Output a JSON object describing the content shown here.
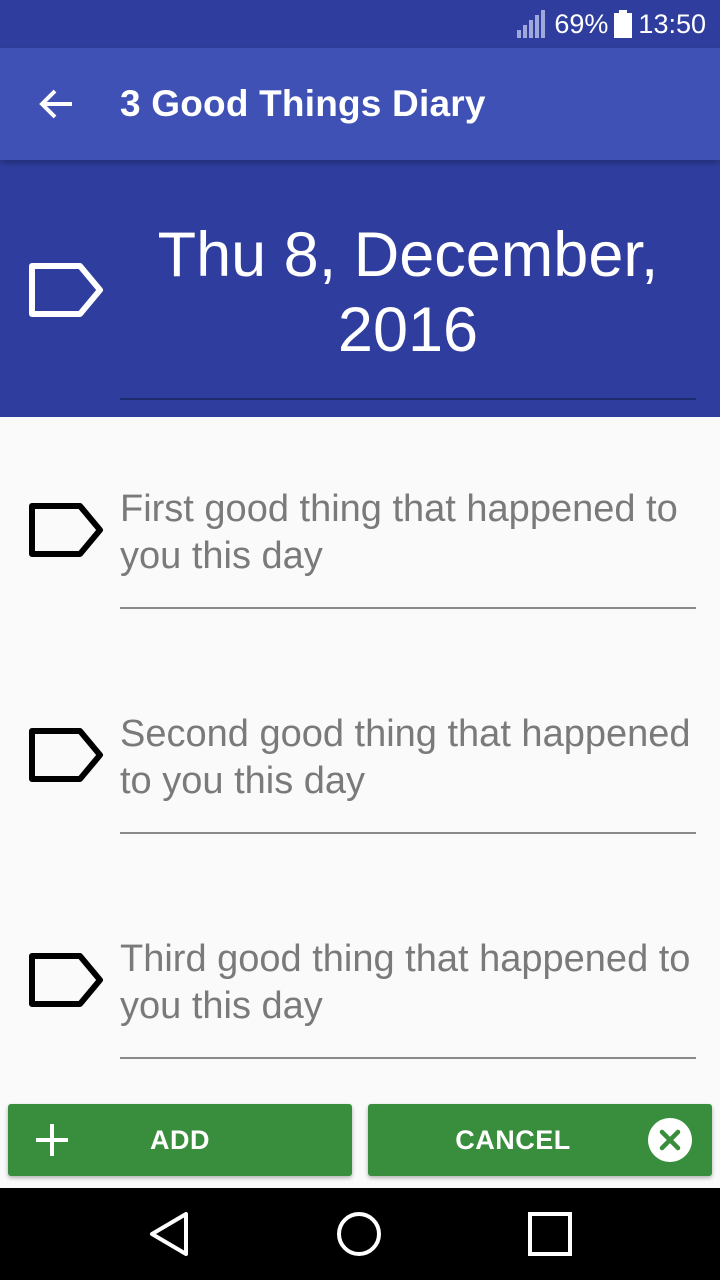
{
  "status_bar": {
    "battery": "69%",
    "time": "13:50"
  },
  "app_bar": {
    "title": "3 Good Things Diary"
  },
  "date_header": {
    "date": "Thu 8, December, 2016"
  },
  "entries": [
    {
      "placeholder": "First good thing that happened to you this day",
      "value": ""
    },
    {
      "placeholder": "Second good thing that happened to you this day",
      "value": ""
    },
    {
      "placeholder": "Third good thing that happened to you this day",
      "value": ""
    }
  ],
  "buttons": {
    "add": "ADD",
    "cancel": "CANCEL"
  },
  "colors": {
    "primary": "#3F51B5",
    "primary_dark": "#2F3E9E",
    "button_green": "#388E3C",
    "background": "#FAFAFA"
  },
  "icons": {
    "back": "arrow-back-icon",
    "tag": "label-tag-icon",
    "add": "plus-icon",
    "cancel": "close-circle-icon",
    "nav": [
      "back-triangle-icon",
      "home-circle-icon",
      "recents-square-icon"
    ]
  }
}
